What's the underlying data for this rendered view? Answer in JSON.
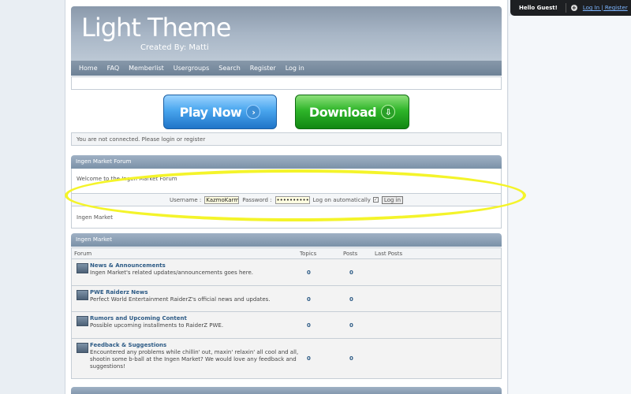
{
  "guest": {
    "hello": "Hello Guest!",
    "links": "Log In | Register"
  },
  "header": {
    "title": "Light Theme",
    "subtitle": "Created By: Matti"
  },
  "nav": [
    "Home",
    "FAQ",
    "Memberlist",
    "Usergroups",
    "Search",
    "Register",
    "Log in"
  ],
  "buttons": {
    "play": "Play Now",
    "download": "Download"
  },
  "notice": "You are not connected. Please login or register",
  "forum_panel": {
    "title": "Ingen Market Forum",
    "welcome": "Welcome to the Ingen Market Forum",
    "login": {
      "username_label": "Username :",
      "username_value": "KazmoKarma",
      "password_label": "Password :",
      "password_value": "••••••••••",
      "auto_label": "Log on automatically",
      "button": "Log in"
    },
    "crumb": "Ingen Market"
  },
  "market": {
    "title": "Ingen Market",
    "columns": {
      "forum": "Forum",
      "topics": "Topics",
      "posts": "Posts",
      "last": "Last Posts"
    },
    "rows": [
      {
        "title": "News & Announcements",
        "desc": "Ingen Market's related updates/announcements goes here.",
        "topics": "0",
        "posts": "0"
      },
      {
        "title": "PWE Raiderz News",
        "desc": "Perfect World Entertainment RaiderZ's official news and updates.",
        "topics": "0",
        "posts": "0"
      },
      {
        "title": "Rumors and Upcoming Content",
        "desc": "Possible upcoming installments to RaiderZ PWE.",
        "topics": "0",
        "posts": "0"
      },
      {
        "title": "Feedback & Suggestions",
        "desc": "Encountered any problems while chillin' out, maxin' relaxin' all cool and all, shootin some b-ball at the Ingen Market? We would love any feedback and suggestions!",
        "topics": "0",
        "posts": "0"
      }
    ]
  }
}
